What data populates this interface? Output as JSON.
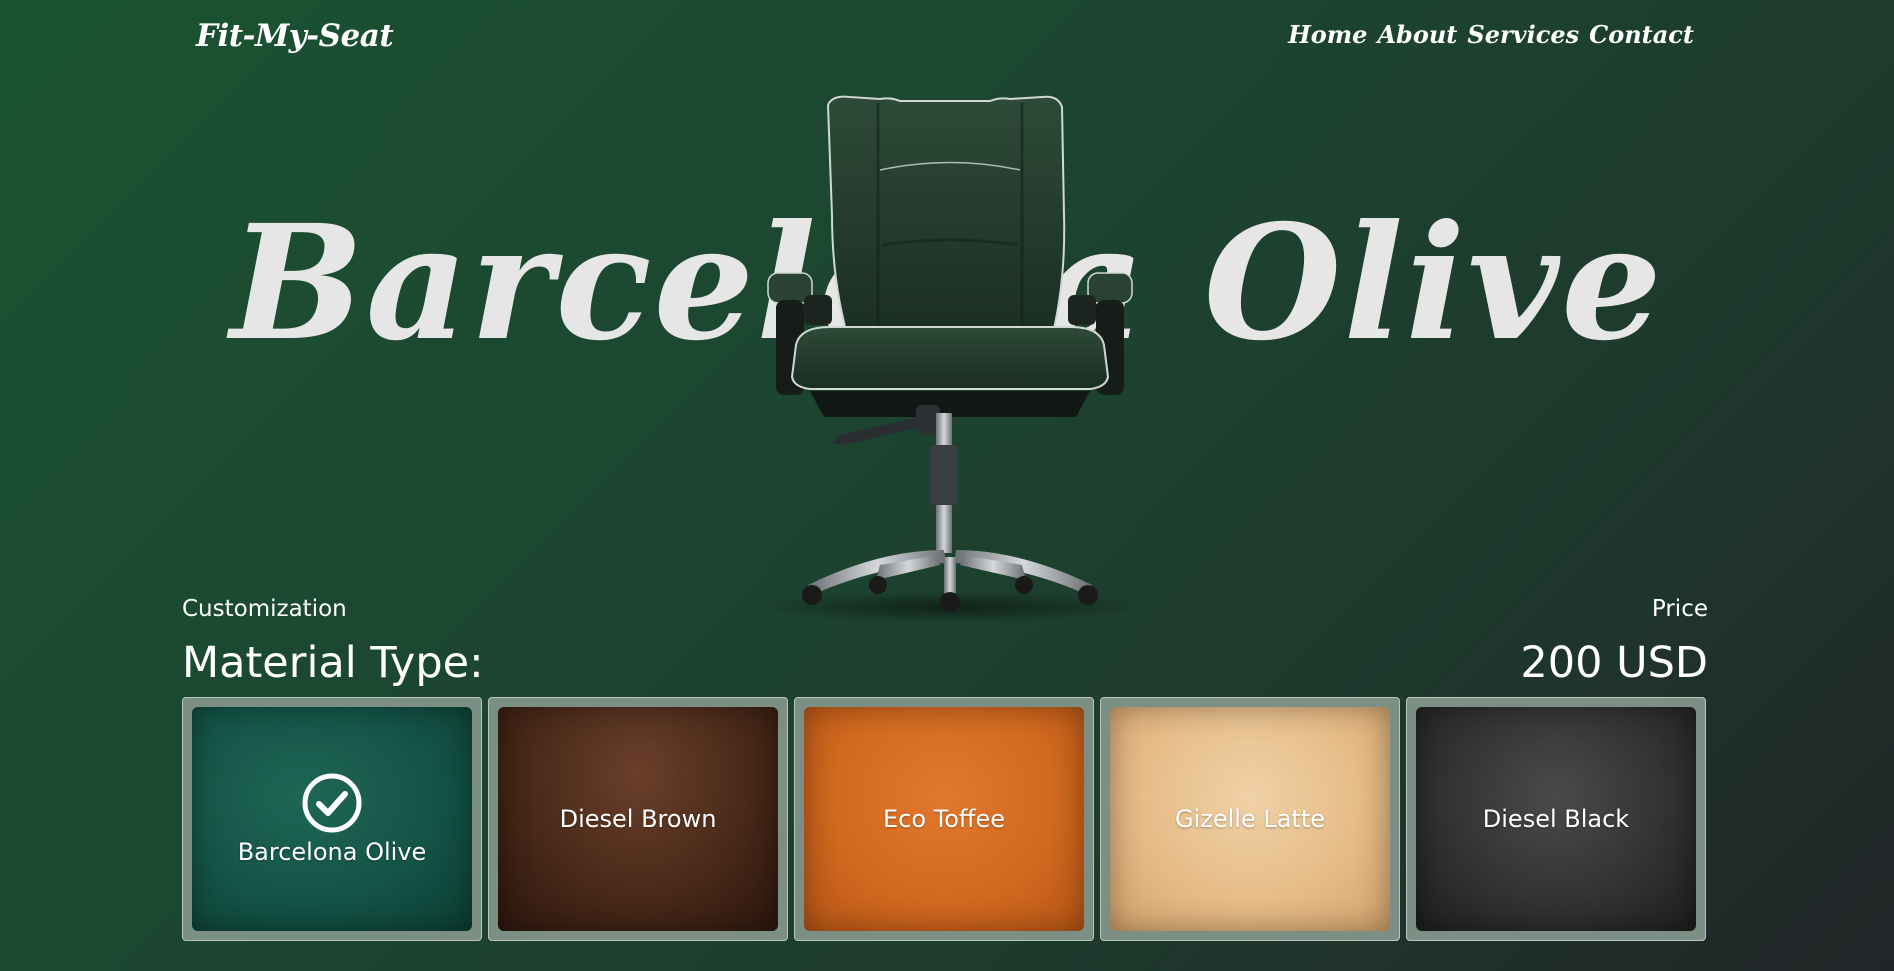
{
  "header": {
    "logo": "Fit-My-Seat",
    "nav": [
      "Home",
      "About",
      "Services",
      "Contact"
    ]
  },
  "hero": {
    "title": "Barcelona Olive",
    "image": "office-chair-icon"
  },
  "customization": {
    "label": "Customization",
    "heading": "Material Type:"
  },
  "price": {
    "label": "Price",
    "value": "200 USD"
  },
  "materials": [
    {
      "label": "Barcelona Olive",
      "color": "#145447",
      "selected": true
    },
    {
      "label": "Diesel Brown",
      "color": "#4a2919",
      "selected": false
    },
    {
      "label": "Eco Toffee",
      "color": "#d2691f",
      "selected": false
    },
    {
      "label": "Gizelle Latte",
      "color": "#e6bc87",
      "selected": false
    },
    {
      "label": "Diesel Black",
      "color": "#333333",
      "selected": false
    }
  ],
  "colors": {
    "accent": "#1b5331",
    "swatch_frame": "#7c8f84"
  }
}
